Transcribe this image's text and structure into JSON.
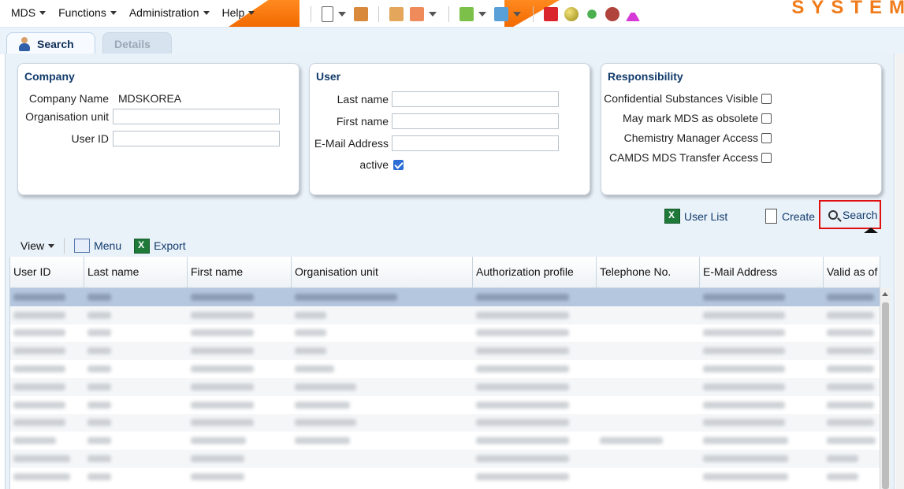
{
  "menubar": {
    "items": [
      "MDS",
      "Functions",
      "Administration",
      "Help"
    ],
    "logo_text": "SYSTEM",
    "accent": "#f26a00"
  },
  "tabs": [
    {
      "label": "Search",
      "active": true
    },
    {
      "label": "Details",
      "active": false
    }
  ],
  "company": {
    "title": "Company",
    "company_name_label": "Company Name",
    "company_name_value": "MDSKOREA",
    "org_unit_label": "Organisation unit",
    "user_id_label": "User ID"
  },
  "user": {
    "title": "User",
    "last_name_label": "Last name",
    "first_name_label": "First name",
    "email_label": "E-Mail Address",
    "active_label": "active",
    "active_checked": true
  },
  "responsibility": {
    "title": "Responsibility",
    "items": [
      {
        "label": "Confidential Substances Visible",
        "checked": false
      },
      {
        "label": "May mark MDS as obsolete",
        "checked": false
      },
      {
        "label": "Chemistry Manager Access",
        "checked": false
      },
      {
        "label": "CAMDS MDS Transfer Access",
        "checked": false
      }
    ]
  },
  "actions": {
    "user_list": "User List",
    "create": "Create",
    "search": "Search",
    "highlight_color": "#e01010"
  },
  "viewbar": {
    "view": "View",
    "menu": "Menu",
    "export": "Export"
  },
  "table": {
    "columns": [
      "User ID",
      "Last name",
      "First name",
      "Organisation unit",
      "Authorization profile",
      "Telephone No.",
      "E-Mail Address",
      "Valid as of"
    ],
    "row_count": 11,
    "selected_row": 0,
    "selection_color": "#b5c7df"
  }
}
